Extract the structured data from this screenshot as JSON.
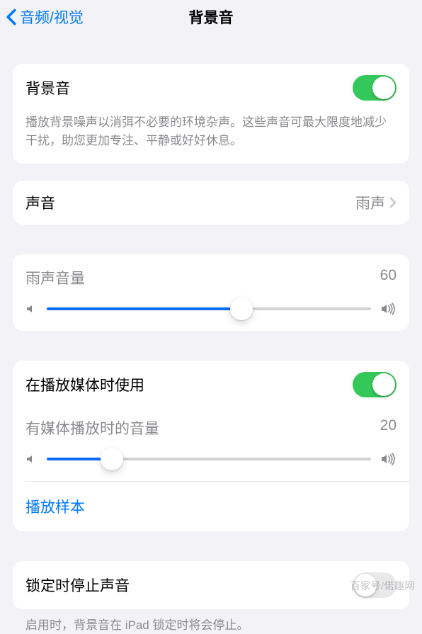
{
  "nav": {
    "back_label": "音频/视觉",
    "title": "背景音"
  },
  "master": {
    "label": "背景音",
    "enabled": true,
    "desc": "播放背景噪声以消弭不必要的环境杂声。这些声音可最大限度地减少干扰，助您更加专注、平静或好好休息。"
  },
  "sound": {
    "label": "声音",
    "value": "雨声"
  },
  "volume": {
    "label": "雨声音量",
    "value": 60
  },
  "media": {
    "toggle_label": "在播放媒体时使用",
    "enabled": true,
    "volume_label": "有媒体播放时的音量",
    "volume_value": 20,
    "sample_link": "播放样本"
  },
  "lock": {
    "label": "锁定时停止声音",
    "enabled": false,
    "desc": "启用时，背景音在 iPad 锁定时将会停止。"
  },
  "watermark": "百家号/偌趣网"
}
